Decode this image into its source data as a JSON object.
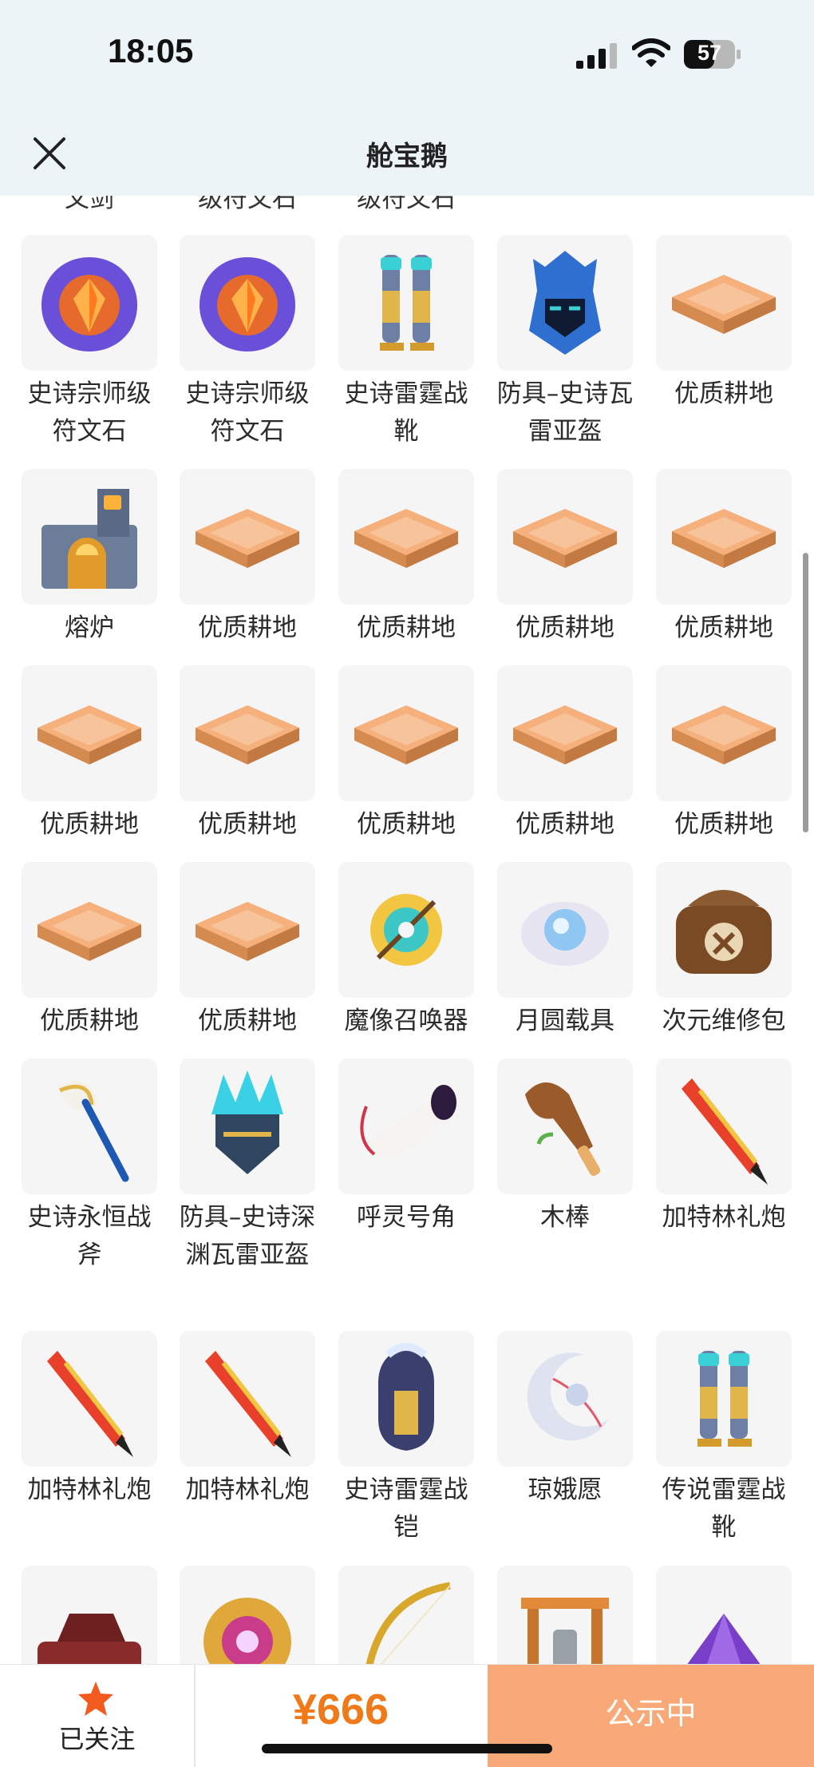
{
  "status_bar": {
    "time": "18:05",
    "battery": "57"
  },
  "header": {
    "title": "舱宝鹅"
  },
  "partial_row": [
    "文剑",
    "级符文石",
    "级符文石"
  ],
  "rows": [
    [
      {
        "label": "史诗宗师级符文石",
        "icon": "rune-stone-icon"
      },
      {
        "label": "史诗宗师级符文石",
        "icon": "rune-stone-icon"
      },
      {
        "label": "史诗雷霆战靴",
        "icon": "boots-icon"
      },
      {
        "label": "防具–史诗瓦雷亚盔",
        "icon": "helmet-icon"
      },
      {
        "label": "优质耕地",
        "icon": "farmland-icon"
      }
    ],
    [
      {
        "label": "熔炉",
        "icon": "furnace-icon"
      },
      {
        "label": "优质耕地",
        "icon": "farmland-icon"
      },
      {
        "label": "优质耕地",
        "icon": "farmland-icon"
      },
      {
        "label": "优质耕地",
        "icon": "farmland-icon"
      },
      {
        "label": "优质耕地",
        "icon": "farmland-icon"
      }
    ],
    [
      {
        "label": "优质耕地",
        "icon": "farmland-icon"
      },
      {
        "label": "优质耕地",
        "icon": "farmland-icon"
      },
      {
        "label": "优质耕地",
        "icon": "farmland-icon"
      },
      {
        "label": "优质耕地",
        "icon": "farmland-icon"
      },
      {
        "label": "优质耕地",
        "icon": "farmland-icon"
      }
    ],
    [
      {
        "label": "优质耕地",
        "icon": "farmland-icon"
      },
      {
        "label": "优质耕地",
        "icon": "farmland-icon"
      },
      {
        "label": "魔像召唤器",
        "icon": "golem-summoner-icon"
      },
      {
        "label": "月圆载具",
        "icon": "moon-vehicle-icon"
      },
      {
        "label": "次元维修包",
        "icon": "repair-bag-icon"
      }
    ],
    [
      {
        "label": "史诗永恒战斧",
        "icon": "axe-icon"
      },
      {
        "label": "防具–史诗深渊瓦雷亚盔",
        "icon": "crystal-helmet-icon"
      },
      {
        "label": "呼灵号角",
        "icon": "horn-icon"
      },
      {
        "label": "木棒",
        "icon": "club-icon"
      },
      {
        "label": "加特林礼炮",
        "icon": "gatling-icon"
      }
    ],
    [
      {
        "label": "加特林礼炮",
        "icon": "gatling-icon"
      },
      {
        "label": "加特林礼炮",
        "icon": "gatling-icon"
      },
      {
        "label": "史诗雷霆战铠",
        "icon": "armor-icon"
      },
      {
        "label": "琼娥愿",
        "icon": "moon-wish-icon"
      },
      {
        "label": "传说雷霆战靴",
        "icon": "boots-icon"
      }
    ],
    [
      {
        "label": "",
        "icon": "car-icon"
      },
      {
        "label": "",
        "icon": "gold-rune-icon"
      },
      {
        "label": "",
        "icon": "bow-icon"
      },
      {
        "label": "",
        "icon": "shrine-icon"
      },
      {
        "label": "",
        "icon": "crystal-pile-icon"
      }
    ]
  ],
  "bottom_bar": {
    "follow_label": "已关注",
    "price": "¥666",
    "cta_label": "公示中"
  }
}
